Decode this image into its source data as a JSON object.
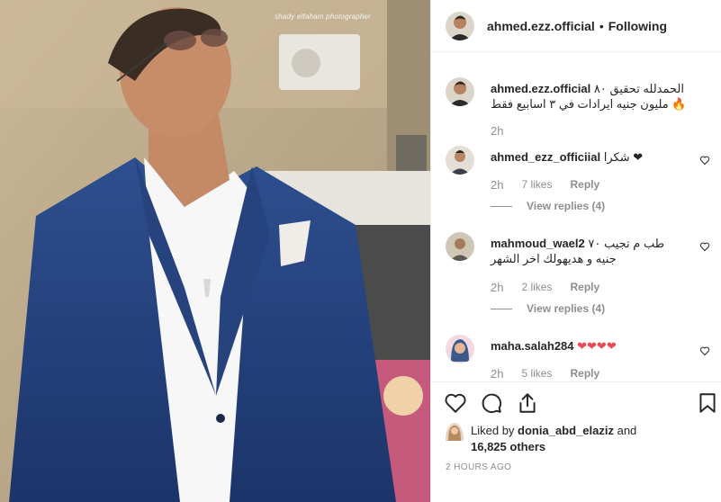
{
  "photo": {
    "credit": "shady elfaham photographer"
  },
  "header": {
    "username": "ahmed.ezz.official",
    "separator": "•",
    "follow_label": "Following"
  },
  "caption": {
    "username": "ahmed.ezz.official",
    "text": "الحمدلله تحقيق ٨٠ مليون جنيه ايرادات في ٣ اسابيع فقط 🔥",
    "time": "2h"
  },
  "comments": [
    {
      "username": "ahmed_ezz_officiial",
      "text": "شكرا ❤",
      "time": "2h",
      "likes": "7 likes",
      "reply": "Reply",
      "view_replies": "View replies (4)"
    },
    {
      "username": "mahmoud_wael2",
      "text": "طب م تجيب ٧٠ جنيه و هديهولك اخر الشهر",
      "time": "2h",
      "likes": "2 likes",
      "reply": "Reply",
      "view_replies": "View replies (4)"
    },
    {
      "username": "maha.salah284",
      "text": "❤❤❤❤",
      "time": "2h",
      "likes": "5 likes",
      "reply": "Reply"
    }
  ],
  "likes": {
    "prefix": "Liked by",
    "user": "donia_abd_elaziz",
    "and": "and",
    "others": "16,825 others"
  },
  "posted": "2 HOURS AGO",
  "icons": [
    "heart-icon",
    "comment-icon",
    "share-icon",
    "bookmark-icon"
  ],
  "colors": {
    "heart": "#ed4956",
    "secondary_text": "#8e8e8e",
    "border": "#efefef"
  }
}
